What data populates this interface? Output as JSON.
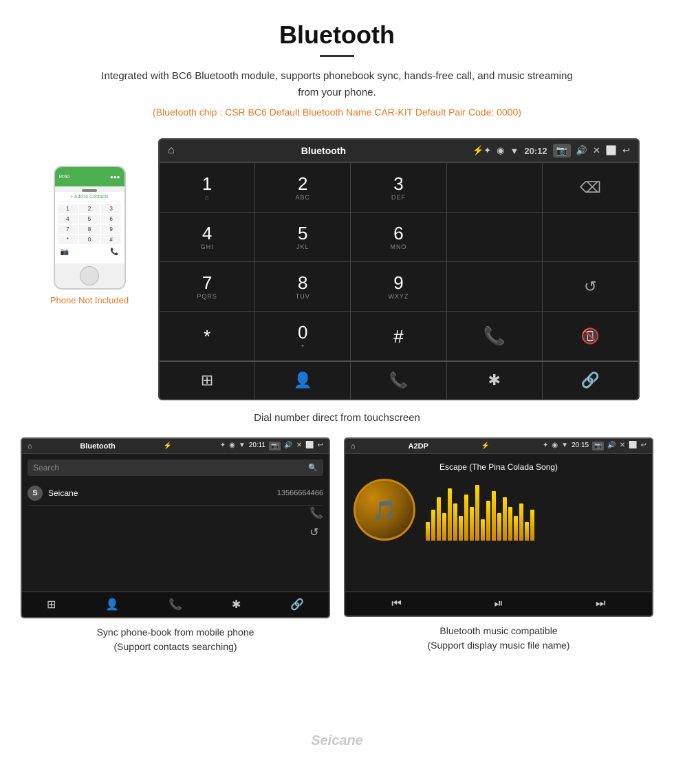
{
  "header": {
    "title": "Bluetooth",
    "description": "Integrated with BC6 Bluetooth module, supports phonebook sync, hands-free call, and music streaming from your phone.",
    "specs": "(Bluetooth chip : CSR BC6    Default Bluetooth Name CAR-KIT    Default Pair Code: 0000)"
  },
  "phone_label": "Phone Not Included",
  "main_screen": {
    "title": "Bluetooth",
    "time": "20:12",
    "dialpad": [
      {
        "num": "1",
        "sub": "⌂"
      },
      {
        "num": "2",
        "sub": "ABC"
      },
      {
        "num": "3",
        "sub": "DEF"
      },
      {
        "num": "",
        "sub": ""
      },
      {
        "num": "⌫",
        "sub": ""
      },
      {
        "num": "4",
        "sub": "GHI"
      },
      {
        "num": "5",
        "sub": "JKL"
      },
      {
        "num": "6",
        "sub": "MNO"
      },
      {
        "num": "",
        "sub": ""
      },
      {
        "num": "",
        "sub": ""
      },
      {
        "num": "7",
        "sub": "PQRS"
      },
      {
        "num": "8",
        "sub": "TUV"
      },
      {
        "num": "9",
        "sub": "WXYZ"
      },
      {
        "num": "",
        "sub": ""
      },
      {
        "num": "↺",
        "sub": ""
      },
      {
        "num": "*",
        "sub": ""
      },
      {
        "num": "0",
        "sub": "+"
      },
      {
        "num": "#",
        "sub": ""
      },
      {
        "num": "📞",
        "sub": ""
      },
      {
        "num": "📞end",
        "sub": ""
      }
    ],
    "bottom_icons": [
      "⊞",
      "👤",
      "📞",
      "✱",
      "🔗"
    ]
  },
  "dial_caption": "Dial number direct from touchscreen",
  "phonebook_screen": {
    "title": "Bluetooth",
    "time": "20:11",
    "search_placeholder": "Search",
    "contact": {
      "letter": "S",
      "name": "Seicane",
      "phone": "13566664466"
    },
    "caption_line1": "Sync phone-book from mobile phone",
    "caption_line2": "(Support contacts searching)"
  },
  "music_screen": {
    "title": "A2DP",
    "time": "20:15",
    "song_title": "Escape (The Pina Colada Song)",
    "caption_line1": "Bluetooth music compatible",
    "caption_line2": "(Support display music file name)"
  },
  "watermark": "Seicane",
  "colors": {
    "orange": "#e87722",
    "green": "#4caf50",
    "red": "#f44336",
    "gold": "#ffd700",
    "screen_bg": "#1a1a1a",
    "header_bg": "#2a2a2a"
  }
}
